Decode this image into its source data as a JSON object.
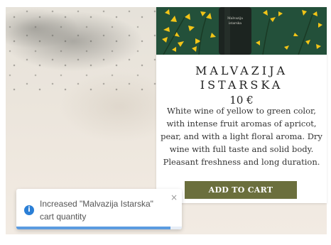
{
  "product": {
    "name_line1": "MALVAZIJA",
    "name_line2": "ISTARSKA",
    "price": "10 €",
    "description": "White wine of yellow to green color, with intense fruit aromas of apricot, pear, and with a light floral aroma. Dry wine with full taste and solid body. Pleasant freshness and long duration.",
    "bottle_label": "Malvazija istarska",
    "add_to_cart_label": "ADD TO CART",
    "button_color": "#6b6f3d"
  },
  "toast": {
    "message": "Increased \"Malvazija Istarska\" cart quantity",
    "icon": "info-icon",
    "icon_color": "#2b7fd6",
    "close_glyph": "×",
    "progress": 0.93
  }
}
